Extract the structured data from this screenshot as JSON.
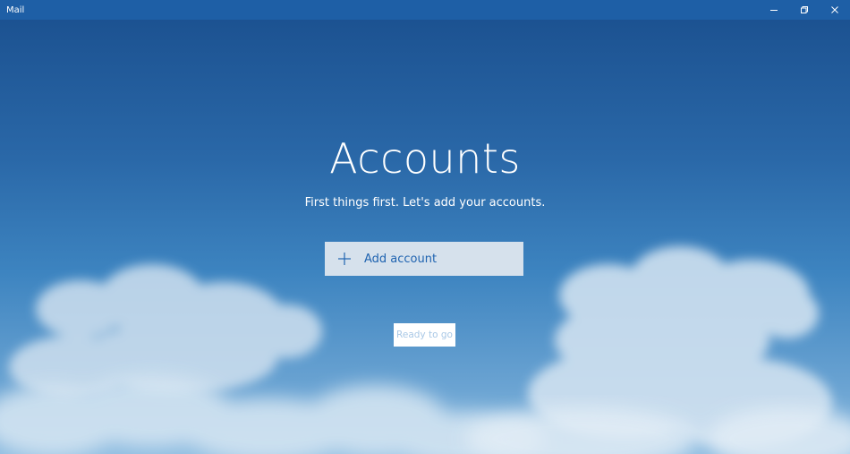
{
  "window": {
    "title": "Mail",
    "controls": {
      "minimize": "minimize-icon",
      "restore": "restore-icon",
      "close": "close-icon"
    }
  },
  "main": {
    "heading": "Accounts",
    "subheading": "First things first. Let's add your accounts.",
    "add_account_label": "Add account",
    "add_account_icon": "plus-icon",
    "ready_label": "Ready to go"
  },
  "colors": {
    "titlebar": "#1e5fa6",
    "accent": "#1f63b0",
    "add_button_bg": "#d6e1ec",
    "ready_text_disabled": "#a9c8e6"
  }
}
